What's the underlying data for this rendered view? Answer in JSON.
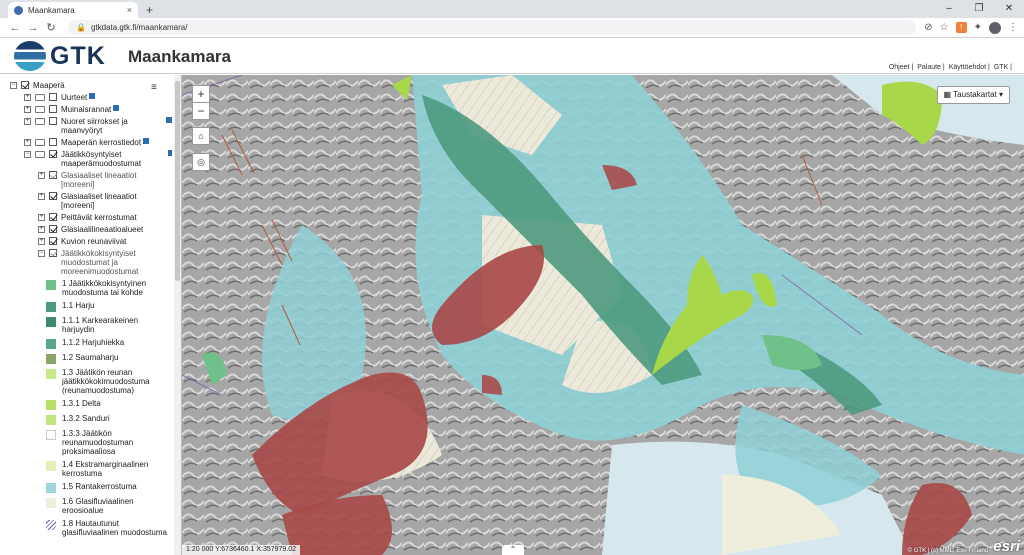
{
  "browser": {
    "tab_title": "Maankamara",
    "tab_close": "×",
    "new_tab": "+",
    "url": "gtkdata.gtk.fi/maankamara/",
    "win_min": "–",
    "win_max": "❐",
    "win_close": "✕"
  },
  "header": {
    "logo_text": "GTK",
    "app_title": "Maankamara",
    "links": [
      "Ohjeet |",
      "Palaute |",
      "Käyttöehdot |",
      "GTK |"
    ]
  },
  "sidebar": {
    "menu_icon": "≡",
    "tree": [
      {
        "label": "Maaperä",
        "level": 0,
        "exp": "⊟",
        "checked": true
      },
      {
        "label": "Uurteet",
        "level": 1,
        "exp": "⊞",
        "checked": false,
        "info": true
      },
      {
        "label": "Muinaisrannat",
        "level": 1,
        "exp": "⊞",
        "checked": false,
        "info": true
      },
      {
        "label": "Nuoret siirrokset ja maanvyöryt",
        "level": 1,
        "exp": "⊞",
        "checked": false,
        "info": true
      },
      {
        "label": "Maaperän kerrostiedot",
        "level": 1,
        "exp": "⊞",
        "checked": false,
        "info": true
      },
      {
        "label": "Jäätikkösyntyiset maaperämuodostumat",
        "level": 1,
        "exp": "⊟",
        "checked": true,
        "info": true
      },
      {
        "label": "Glasiaaliset lineaatiot [moreeni]",
        "level": 2,
        "exp": "⊞",
        "checked": true,
        "dim": true
      },
      {
        "label": "Glasiaaliset lineaatiot [moreeni]",
        "level": 2,
        "exp": "⊞",
        "checked": true
      },
      {
        "label": "Peittävät kerrostumat",
        "level": 2,
        "exp": "⊞",
        "checked": true
      },
      {
        "label": "Glasiaalilineaatioalueet",
        "level": 2,
        "exp": "⊞",
        "checked": true
      },
      {
        "label": "Kuvion reunaviivat",
        "level": 2,
        "exp": "⊞",
        "checked": true
      },
      {
        "label": "Jäätikkökokisyntyiset muodostumat ja moreenimuodostumat",
        "level": 2,
        "exp": "⊟",
        "checked": true,
        "dim": true
      }
    ],
    "legend": [
      {
        "label": "1 Jäätikkökokisyntyinen muodostuma tai kohde",
        "color": "#6fc18a"
      },
      {
        "label": "1.1 Harju",
        "color": "#4e9a7e"
      },
      {
        "label": "1.1.1 Karkearakeinen harjuydin",
        "color": "#3e8a72"
      },
      {
        "label": "1.1.2 Harjuhiekka",
        "color": "#5aa88c"
      },
      {
        "label": "1.2 Saumaharju",
        "color": "#8aa46a"
      },
      {
        "label": "1.3 Jäätikön reunan jäätikkökokimuodostuma (reunamuodostuma)",
        "color": "#c8ea8a"
      },
      {
        "label": "1.3.1 Delta",
        "color": "#b7e06a"
      },
      {
        "label": "1.3.2 Sanduri",
        "color": "#c2e47c"
      },
      {
        "label": "1.3.3 Jäätikön reunamuodostuman proksimaaliosa",
        "color": "#ffffff"
      },
      {
        "label": "1.4 Ekstramarginaalinen kerrostuma",
        "color": "#e6efb8"
      },
      {
        "label": "1.5 Rantakerrostuma",
        "color": "#9fd6da"
      },
      {
        "label": "1.6 Glasifluviaalinen eroosioalue",
        "color": "#efeedd"
      },
      {
        "label": "1.8 Hautautunut glasifluviaalinen muodostuma",
        "color": "hatch"
      }
    ]
  },
  "map": {
    "zoom_in": "+",
    "zoom_out": "−",
    "home_icon": "⌂",
    "locate_icon": "◎",
    "basemap_label": "▦ Taustakartat ▾",
    "status": "1:20 000   Y:6736460.1  X:357979.02",
    "attribution": "© GTK | (c) MML, Esri Finland",
    "esri": "esri",
    "expand_up": "⌃",
    "collapse_left": "‹"
  }
}
